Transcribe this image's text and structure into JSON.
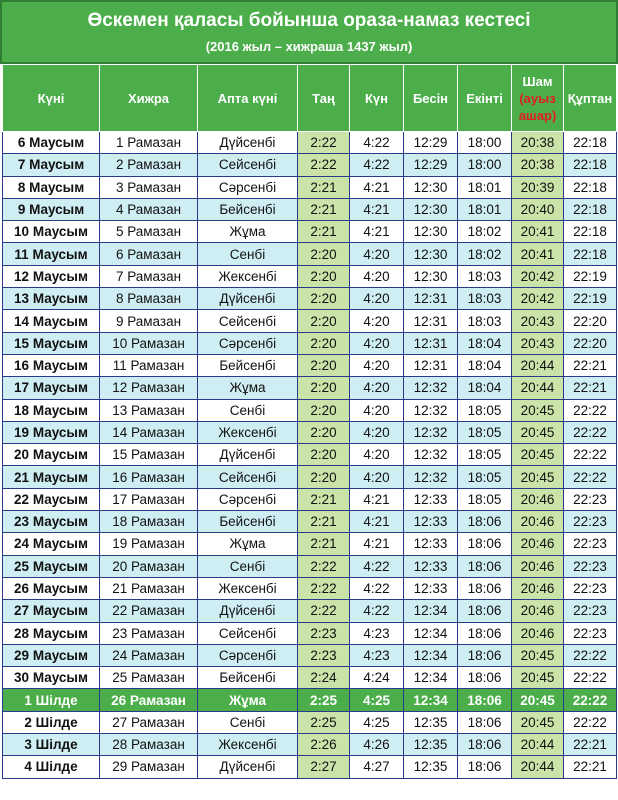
{
  "header": {
    "title": "Өскемен қаласы бойынша ораза-намаз кестесі",
    "subtitle": "(2016 жыл – хижраша 1437 жыл)"
  },
  "columns": {
    "day": "Күні",
    "hijri": "Хижра",
    "weekday": "Апта күні",
    "fajr": "Таң",
    "sunrise": "Күн",
    "dhuhr": "Бесін",
    "asr": "Екінті",
    "maghrib": "Шам",
    "maghrib_note": "(ауыз ашар)",
    "isha": "Құптан"
  },
  "colors": {
    "header_green": "#4cae4a",
    "row_cyan": "#cfeef4",
    "highlight_col": "#c9e3a8",
    "iftar_red": "#e02020"
  },
  "rows": [
    {
      "day": "6 Маусым",
      "hijri": "1 Рамазан",
      "weekday": "Дүйсенбі",
      "fajr": "2:22",
      "sunrise": "4:22",
      "dhuhr": "12:29",
      "asr": "18:00",
      "maghrib": "20:38",
      "isha": "22:18"
    },
    {
      "day": "7 Маусым",
      "hijri": "2 Рамазан",
      "weekday": "Сейсенбі",
      "fajr": "2:22",
      "sunrise": "4:22",
      "dhuhr": "12:29",
      "asr": "18:00",
      "maghrib": "20:38",
      "isha": "22:18"
    },
    {
      "day": "8 Маусым",
      "hijri": "3 Рамазан",
      "weekday": "Сәрсенбі",
      "fajr": "2:21",
      "sunrise": "4:21",
      "dhuhr": "12:30",
      "asr": "18:01",
      "maghrib": "20:39",
      "isha": "22:18"
    },
    {
      "day": "9 Маусым",
      "hijri": "4 Рамазан",
      "weekday": "Бейсенбі",
      "fajr": "2:21",
      "sunrise": "4:21",
      "dhuhr": "12:30",
      "asr": "18:01",
      "maghrib": "20:40",
      "isha": "22:18"
    },
    {
      "day": "10 Маусым",
      "hijri": "5 Рамазан",
      "weekday": "Жұма",
      "fajr": "2:21",
      "sunrise": "4:21",
      "dhuhr": "12:30",
      "asr": "18:02",
      "maghrib": "20:41",
      "isha": "22:18"
    },
    {
      "day": "11 Маусым",
      "hijri": "6 Рамазан",
      "weekday": "Сенбі",
      "fajr": "2:20",
      "sunrise": "4:20",
      "dhuhr": "12:30",
      "asr": "18:02",
      "maghrib": "20:41",
      "isha": "22:18"
    },
    {
      "day": "12 Маусым",
      "hijri": "7 Рамазан",
      "weekday": "Жексенбі",
      "fajr": "2:20",
      "sunrise": "4:20",
      "dhuhr": "12:30",
      "asr": "18:03",
      "maghrib": "20:42",
      "isha": "22:19"
    },
    {
      "day": "13 Маусым",
      "hijri": "8 Рамазан",
      "weekday": "Дүйсенбі",
      "fajr": "2:20",
      "sunrise": "4:20",
      "dhuhr": "12:31",
      "asr": "18:03",
      "maghrib": "20:42",
      "isha": "22:19"
    },
    {
      "day": "14 Маусым",
      "hijri": "9 Рамазан",
      "weekday": "Сейсенбі",
      "fajr": "2:20",
      "sunrise": "4:20",
      "dhuhr": "12:31",
      "asr": "18:03",
      "maghrib": "20:43",
      "isha": "22:20"
    },
    {
      "day": "15 Маусым",
      "hijri": "10 Рамазан",
      "weekday": "Сәрсенбі",
      "fajr": "2:20",
      "sunrise": "4:20",
      "dhuhr": "12:31",
      "asr": "18:04",
      "maghrib": "20:43",
      "isha": "22:20"
    },
    {
      "day": "16 Маусым",
      "hijri": "11 Рамазан",
      "weekday": "Бейсенбі",
      "fajr": "2:20",
      "sunrise": "4:20",
      "dhuhr": "12:31",
      "asr": "18:04",
      "maghrib": "20:44",
      "isha": "22:21"
    },
    {
      "day": "17 Маусым",
      "hijri": "12 Рамазан",
      "weekday": "Жұма",
      "fajr": "2:20",
      "sunrise": "4:20",
      "dhuhr": "12:32",
      "asr": "18:04",
      "maghrib": "20:44",
      "isha": "22:21"
    },
    {
      "day": "18 Маусым",
      "hijri": "13 Рамазан",
      "weekday": "Сенбі",
      "fajr": "2:20",
      "sunrise": "4:20",
      "dhuhr": "12:32",
      "asr": "18:05",
      "maghrib": "20:45",
      "isha": "22:22"
    },
    {
      "day": "19 Маусым",
      "hijri": "14 Рамазан",
      "weekday": "Жексенбі",
      "fajr": "2:20",
      "sunrise": "4:20",
      "dhuhr": "12:32",
      "asr": "18:05",
      "maghrib": "20:45",
      "isha": "22:22"
    },
    {
      "day": "20 Маусым",
      "hijri": "15 Рамазан",
      "weekday": "Дүйсенбі",
      "fajr": "2:20",
      "sunrise": "4:20",
      "dhuhr": "12:32",
      "asr": "18:05",
      "maghrib": "20:45",
      "isha": "22:22"
    },
    {
      "day": "21 Маусым",
      "hijri": "16 Рамазан",
      "weekday": "Сейсенбі",
      "fajr": "2:20",
      "sunrise": "4:20",
      "dhuhr": "12:32",
      "asr": "18:05",
      "maghrib": "20:45",
      "isha": "22:22"
    },
    {
      "day": "22 Маусым",
      "hijri": "17 Рамазан",
      "weekday": "Сәрсенбі",
      "fajr": "2:21",
      "sunrise": "4:21",
      "dhuhr": "12:33",
      "asr": "18:05",
      "maghrib": "20:46",
      "isha": "22:23"
    },
    {
      "day": "23 Маусым",
      "hijri": "18 Рамазан",
      "weekday": "Бейсенбі",
      "fajr": "2:21",
      "sunrise": "4:21",
      "dhuhr": "12:33",
      "asr": "18:06",
      "maghrib": "20:46",
      "isha": "22:23"
    },
    {
      "day": "24 Маусым",
      "hijri": "19 Рамазан",
      "weekday": "Жұма",
      "fajr": "2:21",
      "sunrise": "4:21",
      "dhuhr": "12:33",
      "asr": "18:06",
      "maghrib": "20:46",
      "isha": "22:23"
    },
    {
      "day": "25 Маусым",
      "hijri": "20 Рамазан",
      "weekday": "Сенбі",
      "fajr": "2:22",
      "sunrise": "4:22",
      "dhuhr": "12:33",
      "asr": "18:06",
      "maghrib": "20:46",
      "isha": "22:23"
    },
    {
      "day": "26 Маусым",
      "hijri": "21 Рамазан",
      "weekday": "Жексенбі",
      "fajr": "2:22",
      "sunrise": "4:22",
      "dhuhr": "12:33",
      "asr": "18:06",
      "maghrib": "20:46",
      "isha": "22:23"
    },
    {
      "day": "27 Маусым",
      "hijri": "22 Рамазан",
      "weekday": "Дүйсенбі",
      "fajr": "2:22",
      "sunrise": "4:22",
      "dhuhr": "12:34",
      "asr": "18:06",
      "maghrib": "20:46",
      "isha": "22:23"
    },
    {
      "day": "28 Маусым",
      "hijri": "23 Рамазан",
      "weekday": "Сейсенбі",
      "fajr": "2:23",
      "sunrise": "4:23",
      "dhuhr": "12:34",
      "asr": "18:06",
      "maghrib": "20:46",
      "isha": "22:23"
    },
    {
      "day": "29 Маусым",
      "hijri": "24 Рамазан",
      "weekday": "Сәрсенбі",
      "fajr": "2:23",
      "sunrise": "4:23",
      "dhuhr": "12:34",
      "asr": "18:06",
      "maghrib": "20:45",
      "isha": "22:22"
    },
    {
      "day": "30 Маусым",
      "hijri": "25 Рамазан",
      "weekday": "Бейсенбі",
      "fajr": "2:24",
      "sunrise": "4:24",
      "dhuhr": "12:34",
      "asr": "18:06",
      "maghrib": "20:45",
      "isha": "22:22"
    },
    {
      "day": "1 Шілде",
      "hijri": "26 Рамазан",
      "weekday": "Жұма",
      "fajr": "2:25",
      "sunrise": "4:25",
      "dhuhr": "12:34",
      "asr": "18:06",
      "maghrib": "20:45",
      "isha": "22:22",
      "highlight": true
    },
    {
      "day": "2 Шілде",
      "hijri": "27 Рамазан",
      "weekday": "Сенбі",
      "fajr": "2:25",
      "sunrise": "4:25",
      "dhuhr": "12:35",
      "asr": "18:06",
      "maghrib": "20:45",
      "isha": "22:22"
    },
    {
      "day": "3 Шілде",
      "hijri": "28 Рамазан",
      "weekday": "Жексенбі",
      "fajr": "2:26",
      "sunrise": "4:26",
      "dhuhr": "12:35",
      "asr": "18:06",
      "maghrib": "20:44",
      "isha": "22:21"
    },
    {
      "day": "4 Шілде",
      "hijri": "29 Рамазан",
      "weekday": "Дүйсенбі",
      "fajr": "2:27",
      "sunrise": "4:27",
      "dhuhr": "12:35",
      "asr": "18:06",
      "maghrib": "20:44",
      "isha": "22:21"
    }
  ]
}
